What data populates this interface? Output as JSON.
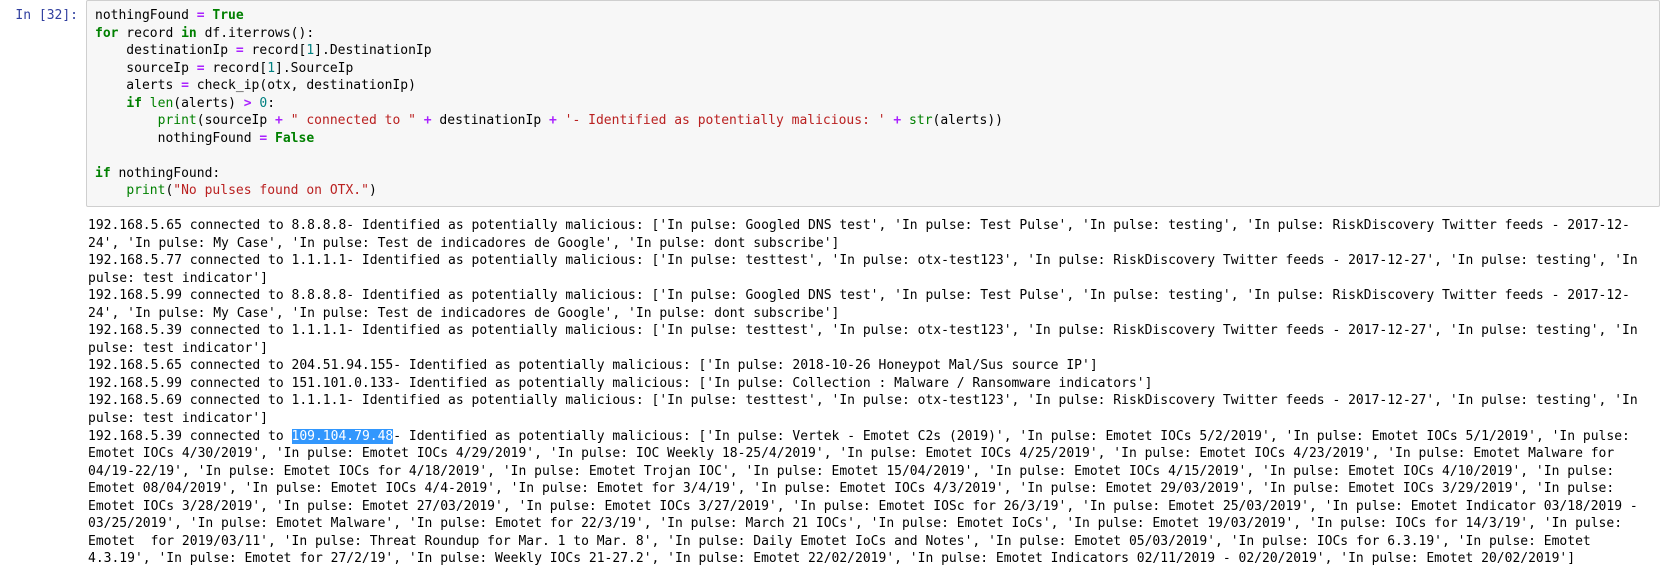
{
  "prompt": {
    "label": "In",
    "number": 32
  },
  "code": {
    "l1": {
      "a": "nothingFound ",
      "op": "=",
      "b": " ",
      "const": "True"
    },
    "l2": {
      "kw1": "for",
      "a": " record ",
      "kw2": "in",
      "b": " df.iterrows():"
    },
    "l3": {
      "a": "    destinationIp ",
      "op": "=",
      "b": " record[",
      "num": "1",
      "c": "].DestinationIp"
    },
    "l4": {
      "a": "    sourceIp ",
      "op": "=",
      "b": " record[",
      "num": "1",
      "c": "].SourceIp"
    },
    "l5": {
      "a": "    alerts ",
      "op": "=",
      "b": " check_ip(otx, destinationIp)"
    },
    "l6": {
      "a": "    ",
      "kw": "if",
      "b": " ",
      "bi": "len",
      "c": "(alerts) ",
      "op": ">",
      "d": " ",
      "num": "0",
      "e": ":"
    },
    "l7": {
      "a": "        ",
      "bi": "print",
      "b": "(sourceIp ",
      "op1": "+",
      "c": " ",
      "s1": "\" connected to \"",
      "d": " ",
      "op2": "+",
      "e": " destinationIp ",
      "op3": "+",
      "f": " ",
      "s2": "'- Identified as potentially malicious: '",
      "g": " ",
      "op4": "+",
      "h": " ",
      "bi2": "str",
      "i": "(alerts))"
    },
    "l8": {
      "a": "        nothingFound ",
      "op": "=",
      "b": " ",
      "const": "False"
    },
    "l9": {
      "kw": "if",
      "a": " nothingFound:"
    },
    "l10": {
      "a": "    ",
      "bi": "print",
      "b": "(",
      "s": "\"No pulses found on OTX.\"",
      "c": ")"
    }
  },
  "highlight_ip": "109.104.79.48",
  "output": {
    "pre": "192.168.5.65 connected to 8.8.8.8- Identified as potentially malicious: ['In pulse: Googled DNS test', 'In pulse: Test Pulse', 'In pulse: testing', 'In pulse: RiskDiscovery Twitter feeds - 2017-12-24', 'In pulse: My Case', 'In pulse: Test de indicadores de Google', 'In pulse: dont subscribe']\n192.168.5.77 connected to 1.1.1.1- Identified as potentially malicious: ['In pulse: testtest', 'In pulse: otx-test123', 'In pulse: RiskDiscovery Twitter feeds - 2017-12-27', 'In pulse: testing', 'In pulse: test indicator']\n192.168.5.99 connected to 8.8.8.8- Identified as potentially malicious: ['In pulse: Googled DNS test', 'In pulse: Test Pulse', 'In pulse: testing', 'In pulse: RiskDiscovery Twitter feeds - 2017-12-24', 'In pulse: My Case', 'In pulse: Test de indicadores de Google', 'In pulse: dont subscribe']\n192.168.5.39 connected to 1.1.1.1- Identified as potentially malicious: ['In pulse: testtest', 'In pulse: otx-test123', 'In pulse: RiskDiscovery Twitter feeds - 2017-12-27', 'In pulse: testing', 'In pulse: test indicator']\n192.168.5.65 connected to 204.51.94.155- Identified as potentially malicious: ['In pulse: 2018-10-26 Honeypot Mal/Sus source IP']\n192.168.5.99 connected to 151.101.0.133- Identified as potentially malicious: ['In pulse: Collection : Malware / Ransomware indicators']\n192.168.5.69 connected to 1.1.1.1- Identified as potentially malicious: ['In pulse: testtest', 'In pulse: otx-test123', 'In pulse: RiskDiscovery Twitter feeds - 2017-12-27', 'In pulse: testing', 'In pulse: test indicator']\n192.168.5.39 connected to ",
    "post": "- Identified as potentially malicious: ['In pulse: Vertek - Emotet C2s (2019)', 'In pulse: Emotet IOCs 5/2/2019', 'In pulse: Emotet IOCs 5/1/2019', 'In pulse: Emotet IOCs 4/30/2019', 'In pulse: Emotet IOCs 4/29/2019', 'In pulse: IOC Weekly 18-25/4/2019', 'In pulse: Emotet IOCs 4/25/2019', 'In pulse: Emotet IOCs 4/23/2019', 'In pulse: Emotet Malware for 04/19-22/19', 'In pulse: Emotet IOCs for 4/18/2019', 'In pulse: Emotet Trojan IOC', 'In pulse: Emotet 15/04/2019', 'In pulse: Emotet IOCs 4/15/2019', 'In pulse: Emotet IOCs 4/10/2019', 'In pulse: Emotet 08/04/2019', 'In pulse: Emotet IOCs 4/4-2019', 'In pulse: Emotet for 3/4/19', 'In pulse: Emotet IOCs 4/3/2019', 'In pulse: Emotet 29/03/2019', 'In pulse: Emotet IOCs 3/29/2019', 'In pulse: Emotet IOCs 3/28/2019', 'In pulse: Emotet 27/03/2019', 'In pulse: Emotet IOCs 3/27/2019', 'In pulse: Emotet IOSc for 26/3/19', 'In pulse: Emotet 25/03/2019', 'In pulse: Emotet Indicator 03/18/2019 - 03/25/2019', 'In pulse: Emotet Malware', 'In pulse: Emotet for 22/3/19', 'In pulse: March 21 IOCs', 'In pulse: Emotet IoCs', 'In pulse: Emotet 19/03/2019', 'In pulse: IOCs for 14/3/19', 'In pulse: Emotet  for 2019/03/11', 'In pulse: Threat Roundup for Mar. 1 to Mar. 8', 'In pulse: Daily Emotet IoCs and Notes', 'In pulse: Emotet 05/03/2019', 'In pulse: IOCs for 6.3.19', 'In pulse: Emotet 4.3.19', 'In pulse: Emotet for 27/2/19', 'In pulse: Weekly IOCs 21-27.2', 'In pulse: Emotet 22/02/2019', 'In pulse: Emotet Indicators 02/11/2019 - 02/20/2019', 'In pulse: Emotet 20/02/2019']"
  }
}
